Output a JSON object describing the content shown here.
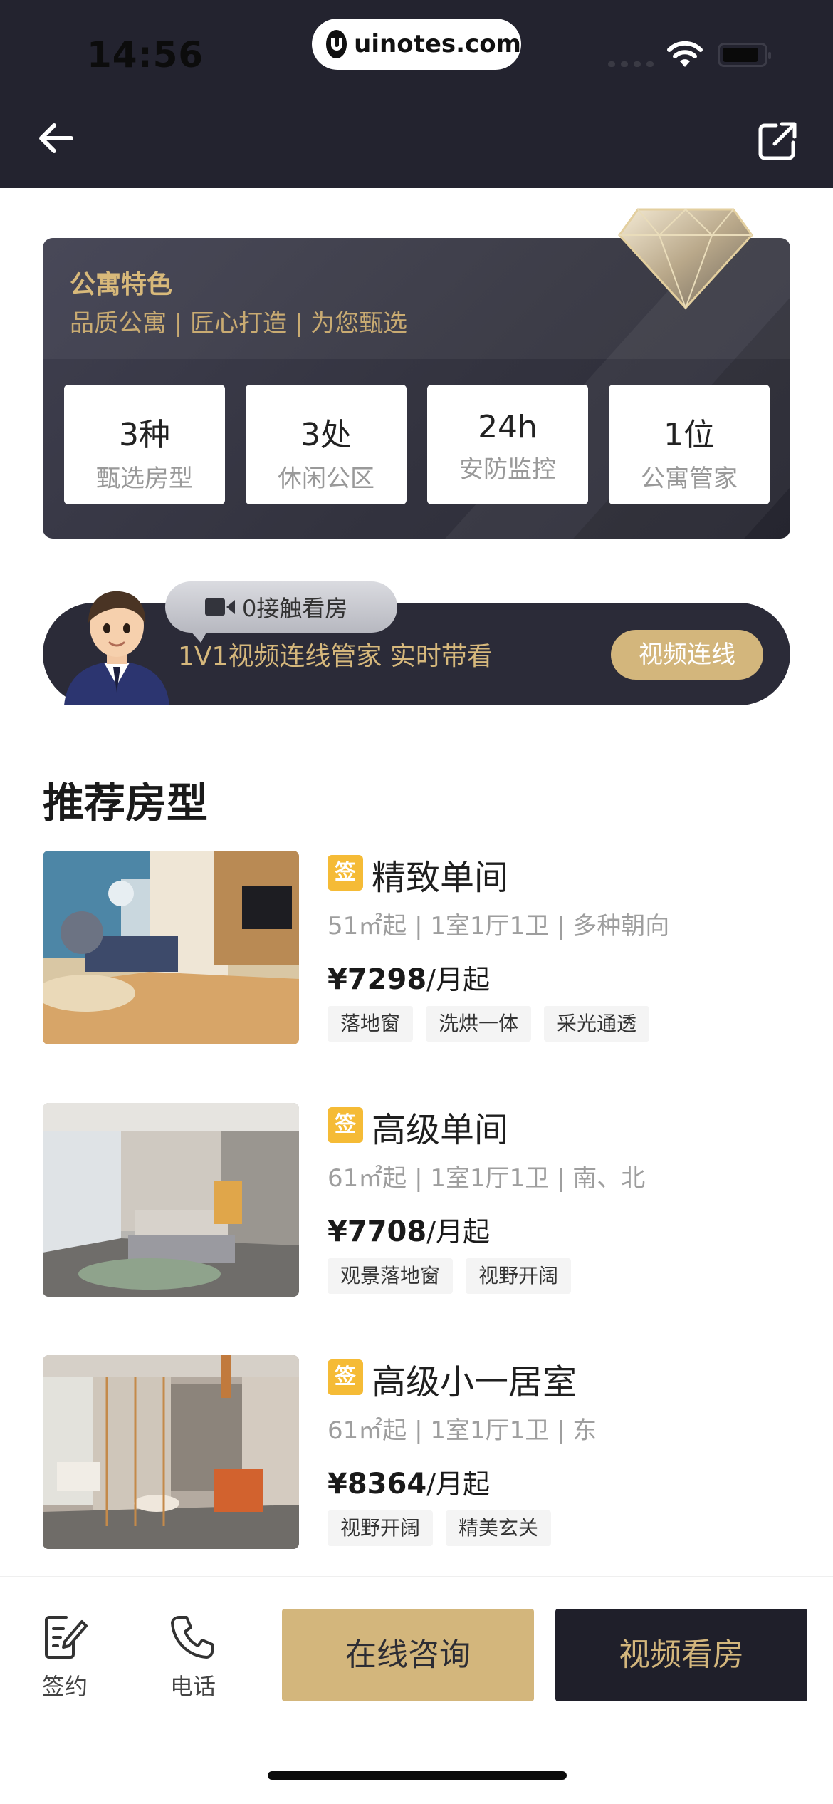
{
  "status": {
    "time": "14:56",
    "domain": "uinotes.com"
  },
  "feature": {
    "title": "公寓特色",
    "subtitle": "品质公寓 | 匠心打造 | 为您甄选",
    "stats": [
      {
        "value": "3种",
        "label": "甄选房型"
      },
      {
        "value": "3处",
        "label": "休闲公区"
      },
      {
        "value": "24h",
        "label": "安防监控"
      },
      {
        "value": "1位",
        "label": "公寓管家"
      }
    ]
  },
  "video_banner": {
    "bubble": "0接触看房",
    "text": "1V1视频连线管家  实时带看",
    "button": "视频连线"
  },
  "section_title": "推荐房型",
  "rooms": [
    {
      "tag": "签",
      "name": "精致单间",
      "spec": "51㎡起 | 1室1厅1卫 | 多种朝向",
      "price": "¥7298",
      "unit": "/月起",
      "chips": [
        "落地窗",
        "洗烘一体",
        "采光通透"
      ]
    },
    {
      "tag": "签",
      "name": "高级单间",
      "spec": "61㎡起 | 1室1厅1卫 | 南、北",
      "price": "¥7708",
      "unit": "/月起",
      "chips": [
        "观景落地窗",
        "视野开阔"
      ]
    },
    {
      "tag": "签",
      "name": "高级小一居室",
      "spec": "61㎡起 | 1室1厅1卫 | 东",
      "price": "¥8364",
      "unit": "/月起",
      "chips": [
        "视野开阔",
        "精美玄关"
      ]
    }
  ],
  "bottom": {
    "sign_label": "签约",
    "phone_label": "电话",
    "consult_label": "在线咨询",
    "video_label": "视频看房"
  },
  "colors": {
    "dark": "#23232f",
    "gold": "#d3b67c",
    "tag": "#f5bb36"
  }
}
